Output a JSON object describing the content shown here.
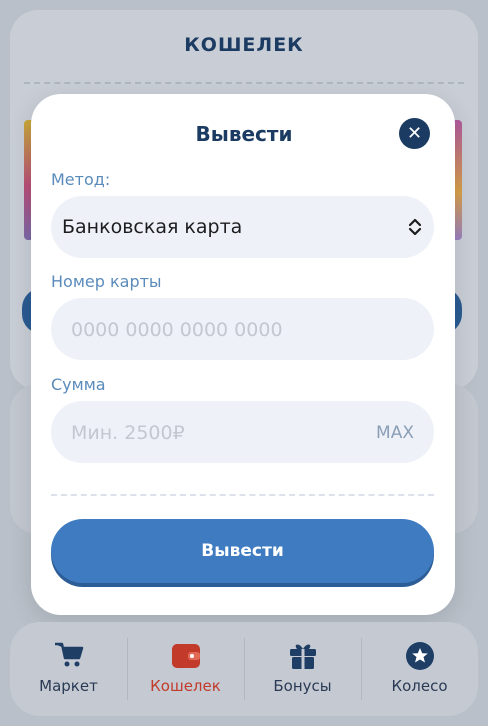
{
  "background": {
    "title": "КОШЕЛЕК"
  },
  "modal": {
    "title": "Вывести",
    "close_icon": "close-icon",
    "method": {
      "label": "Метод:",
      "selected": "Банковская карта",
      "icon": "chevron-up-down-icon"
    },
    "card_number": {
      "label": "Номер карты",
      "placeholder": "0000 0000 0000 0000"
    },
    "amount": {
      "label": "Сумма",
      "placeholder": "Мин. 2500₽",
      "max_label": "MAX"
    },
    "submit_label": "Вывести"
  },
  "nav": {
    "items": [
      {
        "label": "Маркет",
        "icon": "cart-icon",
        "active": false
      },
      {
        "label": "Кошелек",
        "icon": "wallet-icon",
        "active": true
      },
      {
        "label": "Бонусы",
        "icon": "gift-icon",
        "active": false
      },
      {
        "label": "Колесо",
        "icon": "star-circle-icon",
        "active": false
      }
    ]
  },
  "colors": {
    "accent": "#3e7bc1",
    "title": "#1c3b62",
    "label": "#5a8bbb",
    "active_nav": "#c23a2a"
  }
}
